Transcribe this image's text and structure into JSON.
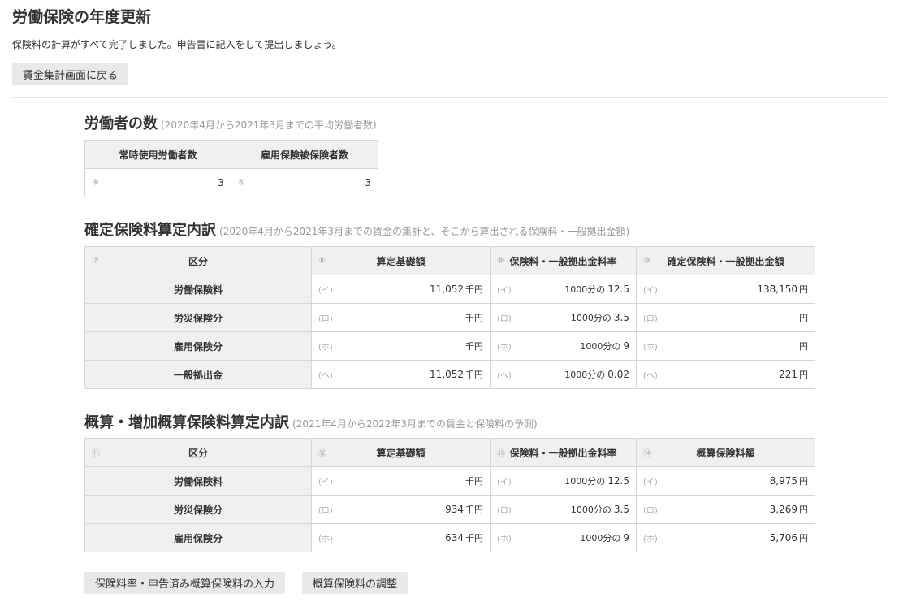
{
  "page": {
    "title": "労働保険の年度更新",
    "lead": "保険料の計算がすべて完了しました。申告書に記入をして提出しましょう。",
    "back_button": "賃金集計画面に戻る"
  },
  "workers": {
    "title": "労働者の数",
    "subtitle": "(2020年4月から2021年3月までの平均労働者数)",
    "headers": [
      "常時使用労働者数",
      "雇用保険被保険者数"
    ],
    "markers": [
      "④",
      "⑤"
    ],
    "values": [
      "3",
      "3"
    ]
  },
  "confirmed": {
    "title": "確定保険料算定内訳",
    "subtitle": "(2020年4月から2021年3月までの賃金の集計と、そこから算出される保険料・一般拠出金額)",
    "header_markers": [
      "⑦",
      "⑧",
      "⑨",
      "⑩"
    ],
    "headers": [
      "区分",
      "算定基礎額",
      "保険料・一般拠出金料率",
      "確定保険料・一般拠出金額"
    ],
    "rows": [
      {
        "category": "労働保険料",
        "marker": "(イ)",
        "base": "11,052",
        "base_unit": "千円",
        "rate_prefix": "1000分の",
        "rate": "12.5",
        "amount": "138,150",
        "amount_unit": "円"
      },
      {
        "category": "労災保険分",
        "marker": "(ロ)",
        "base": "",
        "base_unit": "千円",
        "rate_prefix": "1000分の",
        "rate": "3.5",
        "amount": "",
        "amount_unit": "円"
      },
      {
        "category": "雇用保険分",
        "marker": "(ホ)",
        "base": "",
        "base_unit": "千円",
        "rate_prefix": "1000分の",
        "rate": "9",
        "amount": "",
        "amount_unit": "円"
      },
      {
        "category": "一般拠出金",
        "marker": "(ヘ)",
        "base": "11,052",
        "base_unit": "千円",
        "rate_prefix": "1000分の",
        "rate": "0.02",
        "amount": "221",
        "amount_unit": "円"
      }
    ]
  },
  "estimated": {
    "title": "概算・増加概算保険料算定内訳",
    "subtitle": "(2021年4月から2022年3月までの賃金と保険料の予測)",
    "header_markers": [
      "⑪",
      "⑫",
      "⑬",
      "⑭"
    ],
    "headers": [
      "区分",
      "算定基礎額",
      "保険料・一般拠出金料率",
      "概算保険料額"
    ],
    "rows": [
      {
        "category": "労働保険料",
        "marker": "(イ)",
        "base": "",
        "base_unit": "千円",
        "rate_prefix": "1000分の",
        "rate": "12.5",
        "amount": "8,975",
        "amount_unit": "円"
      },
      {
        "category": "労災保険分",
        "marker": "(ロ)",
        "base": "934",
        "base_unit": "千円",
        "rate_prefix": "1000分の",
        "rate": "3.5",
        "amount": "3,269",
        "amount_unit": "円"
      },
      {
        "category": "雇用保険分",
        "marker": "(ホ)",
        "base": "634",
        "base_unit": "千円",
        "rate_prefix": "1000分の",
        "rate": "9",
        "amount": "5,706",
        "amount_unit": "円"
      }
    ]
  },
  "footer": {
    "rate_input_button": "保険料率・申告済み概算保険料の入力",
    "adjust_button": "概算保険料の調整"
  }
}
